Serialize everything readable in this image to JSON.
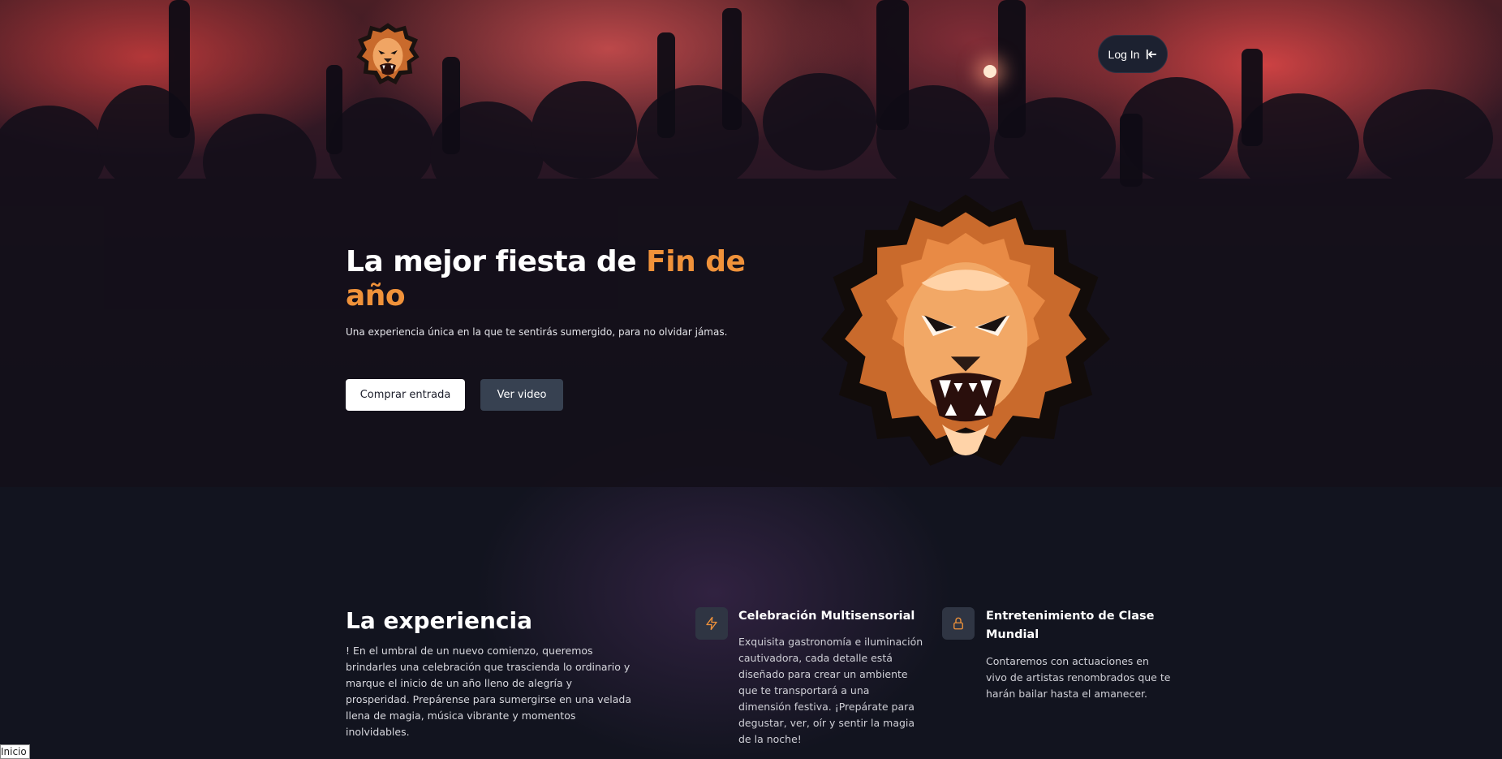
{
  "header": {
    "logo_icon": "lion-head-icon",
    "login_label": "Log In",
    "login_icon": "arrow-to-left-icon"
  },
  "hero": {
    "title_main": "La mejor fiesta de ",
    "title_accent": "Fin de año",
    "subtitle": "Una experiencia única en la que te sentirás sumergido, para no olvidar jámas.",
    "buy_label": "Comprar entrada",
    "video_label": "Ver video",
    "image_icon": "lion-head-icon"
  },
  "experience": {
    "title": "La experiencia",
    "text": "! En el umbral de un nuevo comienzo, queremos brindarles una celebración que trascienda lo ordinario y marque el inicio de un año lleno de alegría y prosperidad. Prepárense para sumergirse en una velada llena de magia, música vibrante y momentos inolvidables."
  },
  "features": [
    {
      "icon": "lightning-bolt-icon",
      "title": "Celebración Multisensorial",
      "text": "Exquisita gastronomía e iluminación cautivadora, cada detalle está diseñado para crear un ambiente que te transportará a una dimensión festiva. ¡Prepárate para degustar, ver, oír y sentir la magia de la noche!"
    },
    {
      "icon": "lock-icon",
      "title": "Entretenimiento de Clase Mundial",
      "text": "Contaremos con actuaciones en vivo de artistas renombrados que te harán bailar hasta el amanecer."
    }
  ],
  "footer": {
    "tab_label": "Inicio"
  },
  "colors": {
    "accent": "#f0923a",
    "background": "#12141f",
    "icon_tile": "#2f3543",
    "video_button": "#374151"
  }
}
